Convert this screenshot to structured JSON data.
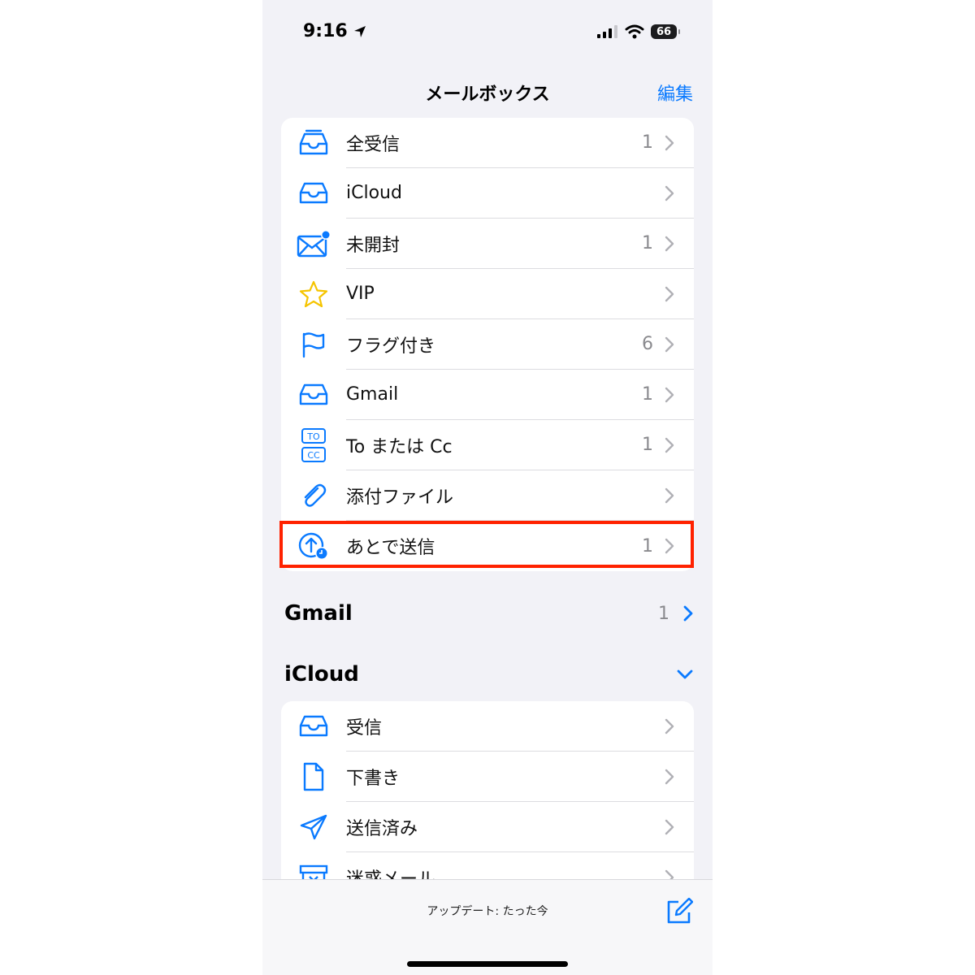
{
  "status": {
    "time": "9:16",
    "battery": "66"
  },
  "nav": {
    "title": "メールボックス",
    "edit": "編集"
  },
  "mailboxes": [
    {
      "label": "全受信",
      "count": "1",
      "icon": "tray-full-icon"
    },
    {
      "label": "iCloud",
      "count": "",
      "icon": "tray-icon"
    },
    {
      "label": "未開封",
      "count": "1",
      "icon": "envelope-badge-icon"
    },
    {
      "label": "VIP",
      "count": "",
      "icon": "star-icon"
    },
    {
      "label": "フラグ付き",
      "count": "6",
      "icon": "flag-icon"
    },
    {
      "label": "Gmail",
      "count": "1",
      "icon": "tray-icon"
    },
    {
      "label": "To または Cc",
      "count": "1",
      "icon": "to-cc-icon"
    },
    {
      "label": "添付ファイル",
      "count": "",
      "icon": "paperclip-icon"
    },
    {
      "label": "あとで送信",
      "count": "1",
      "icon": "send-later-icon"
    }
  ],
  "gmail_section": {
    "title": "Gmail",
    "count": "1"
  },
  "icloud_section": {
    "title": "iCloud"
  },
  "icloud_folders": [
    {
      "label": "受信",
      "icon": "tray-icon"
    },
    {
      "label": "下書き",
      "icon": "document-icon"
    },
    {
      "label": "送信済み",
      "icon": "paperplane-icon"
    },
    {
      "label": "迷惑メール",
      "icon": "junk-icon"
    }
  ],
  "toolbar": {
    "update_text": "アップデート: たった今"
  },
  "colors": {
    "accent": "#0a7aff",
    "star": "#f5c400",
    "highlight": "#ff2200"
  }
}
